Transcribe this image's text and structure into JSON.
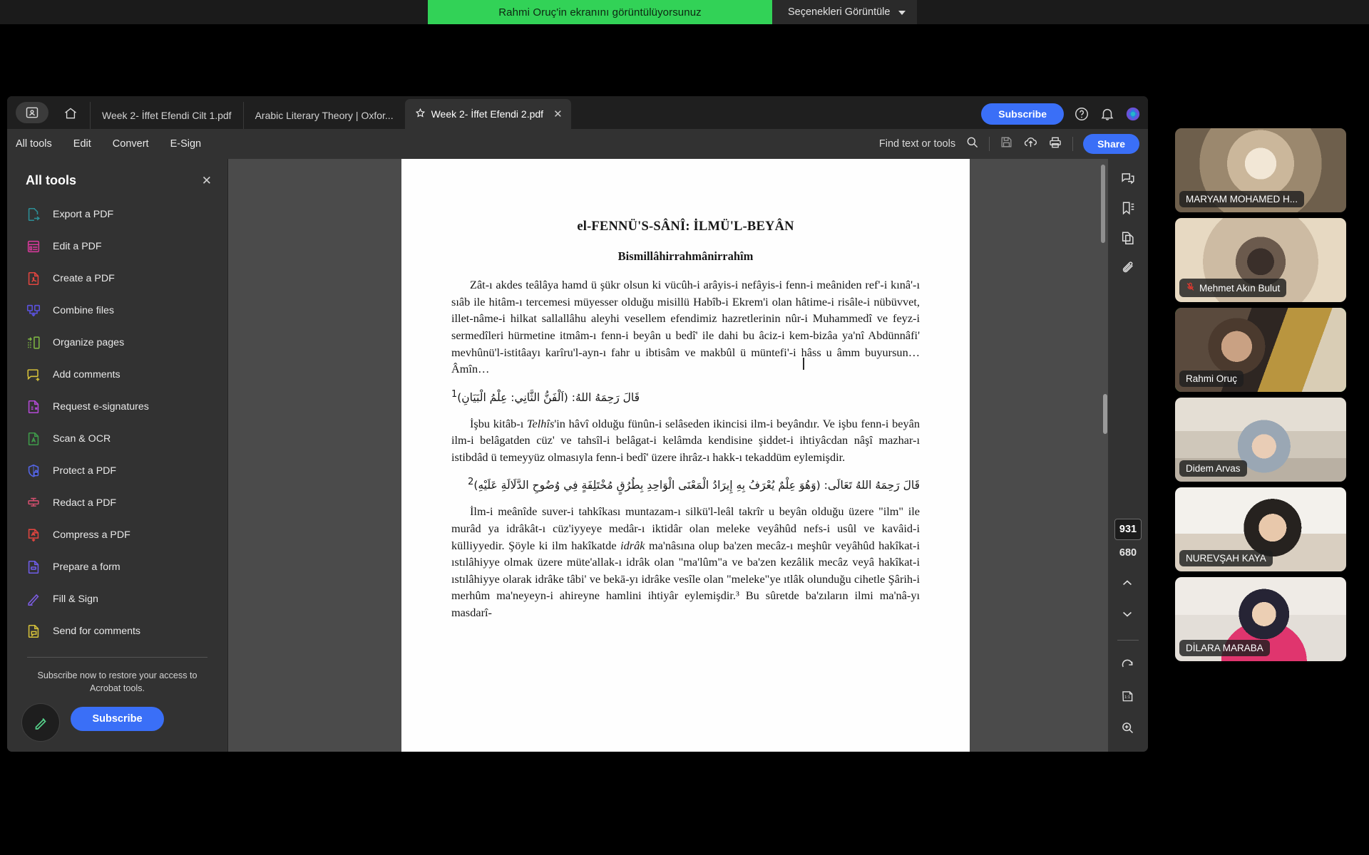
{
  "share_banner": {
    "notice": "Rahmi Oruç'in ekranını görüntülüyorsunuz",
    "options_label": "Seçenekleri Görüntüle",
    "green": "#32d257"
  },
  "acrobat": {
    "accent_blue": "#3a6ff7",
    "tabs": [
      {
        "title": "Week 2- İffet Efendi Cilt 1.pdf",
        "active": false,
        "starred": false,
        "closable": false
      },
      {
        "title": "Arabic Literary Theory | Oxfor...",
        "active": false,
        "starred": false,
        "closable": false
      },
      {
        "title": "Week 2- İffet Efendi 2.pdf",
        "active": true,
        "starred": true,
        "closable": true
      }
    ],
    "tab_close_glyph": "✕",
    "titlebar": {
      "subscribe_label": "Subscribe",
      "help_icon": "help-circle-icon",
      "bell_icon": "notification-bell-icon",
      "avatar_icon": "user-avatar-icon"
    },
    "menu": [
      "All tools",
      "Edit",
      "Convert",
      "E-Sign"
    ],
    "toolbar_right": {
      "find_placeholder": "Find text or tools",
      "search_icon": "search-icon",
      "save_icon": "save-disk-icon",
      "cloud_icon": "cloud-upload-icon",
      "print_icon": "print-icon",
      "share_label": "Share"
    },
    "tools_panel": {
      "title": "All tools",
      "close_glyph": "✕",
      "items": [
        {
          "label": "Export a PDF",
          "icon": "export-pdf-icon",
          "color": "#2d8f96"
        },
        {
          "label": "Edit a PDF",
          "icon": "edit-pdf-icon",
          "color": "#d6399a"
        },
        {
          "label": "Create a PDF",
          "icon": "create-pdf-icon",
          "color": "#e0453f"
        },
        {
          "label": "Combine files",
          "icon": "combine-files-icon",
          "color": "#5b52e0"
        },
        {
          "label": "Organize pages",
          "icon": "organize-pages-icon",
          "color": "#7cb342"
        },
        {
          "label": "Add comments",
          "icon": "add-comments-icon",
          "color": "#d4c03a"
        },
        {
          "label": "Request e-signatures",
          "icon": "request-esign-icon",
          "color": "#b44ad6"
        },
        {
          "label": "Scan & OCR",
          "icon": "scan-ocr-icon",
          "color": "#3f9b4a"
        },
        {
          "label": "Protect a PDF",
          "icon": "protect-pdf-icon",
          "color": "#5566e8"
        },
        {
          "label": "Redact a PDF",
          "icon": "redact-pdf-icon",
          "color": "#d34f6e"
        },
        {
          "label": "Compress a PDF",
          "icon": "compress-pdf-icon",
          "color": "#e0453f"
        },
        {
          "label": "Prepare a form",
          "icon": "prepare-form-icon",
          "color": "#6f5de8"
        },
        {
          "label": "Fill & Sign",
          "icon": "fill-sign-icon",
          "color": "#7b5ce0"
        },
        {
          "label": "Send for comments",
          "icon": "send-for-comments-icon",
          "color": "#d4c03a"
        }
      ],
      "subscribe_note": "Subscribe now to restore your access to Acrobat tools.",
      "subscribe_label": "Subscribe",
      "fab_icon": "edit-pencil-icon"
    },
    "vertical_toolbar": {
      "items": [
        {
          "icon": "select-cursor-icon",
          "selected": true
        },
        {
          "icon": "sticky-note-icon",
          "selected": false
        },
        {
          "icon": "highlight-pen-icon",
          "selected": false
        },
        {
          "icon": "freehand-draw-icon",
          "selected": false
        },
        {
          "icon": "text-box-icon",
          "selected": false
        },
        {
          "icon": "signature-icon",
          "selected": false
        },
        {
          "icon": "more-options-icon",
          "selected": false
        }
      ]
    },
    "right_rail": {
      "top_icons": [
        {
          "icon": "comments-panel-icon"
        },
        {
          "icon": "bookmarks-panel-icon"
        },
        {
          "icon": "page-thumbnails-icon"
        },
        {
          "icon": "attachments-panel-icon"
        }
      ],
      "current_page": "931",
      "total_pages": "680",
      "prev_page_icon": "chevron-up-icon",
      "next_page_icon": "chevron-down-icon",
      "lower_icons": [
        {
          "icon": "rotate-clockwise-icon"
        },
        {
          "icon": "fit-actual-size-icon"
        },
        {
          "icon": "zoom-in-icon"
        },
        {
          "icon": "zoom-out-icon"
        }
      ]
    },
    "document": {
      "heading": "el-FENNÜ'S-SÂNÎ: İLMÜ'L-BEYÂN",
      "subheading": "Bismillâhirrahmânirrahîm",
      "p1": "Zât-ı akdes teâlâya hamd ü şükr olsun ki vücûh-i arâyis-i nefâyis-i fenn-i meâniden ref'-i kınâ'-ı sıâb ile hitâm-ı tercemesi müyesser olduğu misillü Habîb-i Ekrem'i olan hâtime-i risâle-i nübüvvet, illet-nâme-i hilkat sallallâhu aleyhi vesellem efendimiz hazretlerinin nûr-i Muhammedî ve feyz-i sermedîleri hürmetine itmâm-ı fenn-i beyân u bedî' ile dahi bu âciz-i kem-bizâa ya'nî Abdünnâfi' mevhûnü'l-istitâayı karîru'l-ayn-ı fahr u ibtisâm ve makbûl ü müntefi'-i hâss u âmm buyursun… Âmîn…",
      "arabic1": "قَالَ رَحِمَهُ اللهُ: (اَلْفَنُّ الثَّانِي: عِلْمُ الْبَيَانِ)",
      "arabic1_note": "1",
      "p2_a": "İşbu kitâb-ı ",
      "p2_italic": "Telhîs",
      "p2_b": "'in hâvî olduğu fünûn-i selâseden ikincisi ilm-i beyândır. Ve işbu fenn-i beyân ilm-i belâgatden cüz' ve tahsîl-i belâgat-i kelâmda kendisine şiddet-i ihtiyâcdan nâşî mazhar-ı istibdâd ü temeyyüz olmasıyla fenn-i bedî' üzere ihrâz-ı hakk-ı tekaddüm eylemişdir.",
      "arabic2": "قَالَ رَحِمَهُ اللهُ تَعَالَى: (وَهُوَ عِلْمٌ يُعْرَفُ بِهِ إِيرَادُ الْمَعْنَى الْوَاحِدِ بِطُرُقٍ مُخْتَلِفَةٍ فِي وُضُوحِ الدَّلَالَةِ عَلَيْهِ)",
      "arabic2_note": "2",
      "p3_a": "İlm-i meânîde suver-i tahkîkası muntazam-ı silkü'l-leâl takrîr u beyân olduğu üzere \"ilm\" ile murâd ya idrâkât-ı cüz'iyyeye medâr-ı iktidâr olan meleke veyâhûd nefs-i usûl ve kavâid-i külliyyedir. Şöyle ki ilm hakîkatde ",
      "p3_italic": "idrâk",
      "p3_b": " ma'nâsına olup ba'zen mecâz-ı meşhûr veyâhûd hakîkat-i ıstılâhiyye olmak üzere müte'allak-ı idrâk olan \"ma'lûm\"a ve ba'zen kezâlik mecâz veyâ hakîkat-i ıstılâhiyye olarak idrâke tâbi' ve bekā-yı idrâke vesîle olan \"meleke\"ye ıtlâk olunduğu cihetle Şârih-i merhûm ma'neyeyn-i ahireyne hamlini ihtiyâr eylemişdir.³ Bu sûretde ba'zıların ilmi ma'nâ-yı masdarî-"
    }
  },
  "video_panel": {
    "speaking_outline": "#2fd94f",
    "participants": [
      {
        "name": "MARYAM MOHAMED H...",
        "speaking": false,
        "muted": false
      },
      {
        "name": "Mehmet Akın Bulut",
        "speaking": false,
        "muted": true
      },
      {
        "name": "Rahmi Oruç",
        "speaking": true,
        "muted": false
      },
      {
        "name": "Didem Arvas",
        "speaking": false,
        "muted": false
      },
      {
        "name": "NUREVŞAH KAYA",
        "speaking": false,
        "muted": false
      },
      {
        "name": "DİLARA MARABA",
        "speaking": false,
        "muted": false
      }
    ],
    "mic_off_glyph": "🎤"
  }
}
